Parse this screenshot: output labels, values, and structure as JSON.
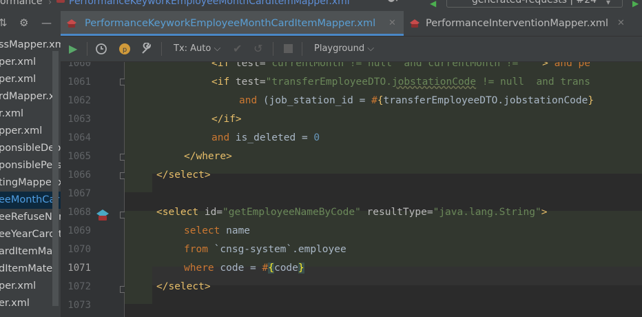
{
  "top": {
    "project_label": "ormance",
    "breadcrumb": "PerformanceKeyworkEmployeeMonthCardItemMapper.xml",
    "run_config": "generated-requests | #24"
  },
  "project_tree": {
    "items": [
      {
        "label": "ssMapper.xm",
        "highlight": false
      },
      {
        "label": "per.xml",
        "highlight": false
      },
      {
        "label": "per.xml",
        "highlight": false
      },
      {
        "label": "rdMapper.x",
        "highlight": false
      },
      {
        "label": "r.xml",
        "highlight": false
      },
      {
        "label": "pper.xml",
        "highlight": false
      },
      {
        "label": "ponsibleDep",
        "highlight": false
      },
      {
        "label": "ponsiblePers",
        "highlight": false
      },
      {
        "label": "tingMapper.x",
        "highlight": false
      },
      {
        "label": "eeMonthCar",
        "highlight": true
      },
      {
        "label": "eeRefuseNur",
        "highlight": false
      },
      {
        "label": "eeYearCardIt",
        "highlight": false
      },
      {
        "label": "ardItemMat",
        "highlight": false
      },
      {
        "label": "dItemMateri",
        "highlight": false
      },
      {
        "label": "per.xml",
        "highlight": false
      },
      {
        "label": "er.xml",
        "highlight": false
      }
    ]
  },
  "tabs": [
    {
      "label": "PerformanceKeyworkEmployeeMonthCardItemMapper.xml",
      "active": true
    },
    {
      "label": "PerformanceInterventionMapper.xml",
      "active": false
    }
  ],
  "toolbar": {
    "tx_label": "Tx: Auto",
    "playground_label": "Playground",
    "icons": [
      "run-icon",
      "history-icon",
      "parameters-icon",
      "settings-wrench-icon",
      "commit-icon",
      "rollback-icon",
      "stop-icon"
    ]
  },
  "editor": {
    "current_line": "1071",
    "lines": [
      {
        "n": "1060",
        "segments": [
          [
            "kw",
            "&lt;if"
          ],
          [
            "txt",
            " test="
          ],
          [
            "str",
            "\"currentMonth != null  and currentMonth != ''\""
          ],
          [
            "tag",
            "&gt;"
          ],
          [
            "kw",
            " and pe"
          ]
        ]
      },
      {
        "n": "1061",
        "segments": []
      },
      {
        "n": "1062",
        "segments": []
      },
      {
        "n": "1063",
        "segments": []
      },
      {
        "n": "1064",
        "segments": []
      },
      {
        "n": "1065",
        "segments": []
      },
      {
        "n": "1066",
        "segments": []
      },
      {
        "n": "1067",
        "segments": []
      },
      {
        "n": "1068",
        "segments": []
      },
      {
        "n": "1069",
        "segments": []
      },
      {
        "n": "1070",
        "segments": []
      },
      {
        "n": "1071",
        "segments": []
      },
      {
        "n": "1072",
        "segments": []
      },
      {
        "n": "1073",
        "segments": []
      }
    ],
    "code": {
      "l1060": {
        "if": "<if",
        "test": " test=",
        "val": "\"currentMonth != null  and currentMonth != ''\"",
        "close": ">",
        "and": " and pe"
      },
      "l1061": {
        "if": "<if",
        "test": " test=",
        "q1": "\"transferEmployeeDTO.",
        "und": "jobstationCode",
        "q2": " != null  and trans"
      },
      "l1062": {
        "and": "and",
        "rest": " (job_station_id = ",
        "hash": "#",
        "b1": "{",
        "param": "transferEmployeeDTO.jobstationCode",
        "b2": "}"
      },
      "l1063": {
        "tag": "</if>"
      },
      "l1064": {
        "and": "and",
        "rest": " is_deleted = ",
        "num": "0"
      },
      "l1065": {
        "tag": "</where>"
      },
      "l1066": {
        "tag": "</select>"
      },
      "l1068": {
        "open": "<select",
        "id_attr": " id=",
        "id_val": "\"getEmployeeNameByCode\"",
        "rt_attr": " resultType=",
        "rt_val": "\"java.lang.String\"",
        "close": ">"
      },
      "l1069": {
        "kw": "select",
        "rest": " name"
      },
      "l1070": {
        "kw": "from",
        "rest": " `cnsg-system`.employee"
      },
      "l1071": {
        "kw": "where",
        "rest": " code = ",
        "hash": "#",
        "b1": "{",
        "param": "code",
        "b2": "}"
      },
      "l1072": {
        "tag": "</select>"
      }
    }
  }
}
